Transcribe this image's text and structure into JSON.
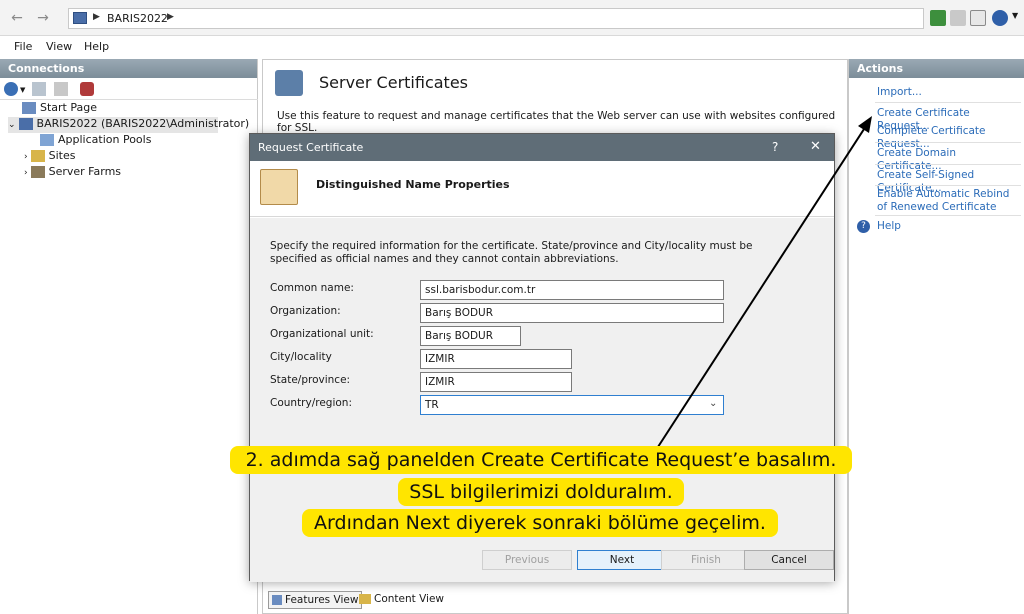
{
  "address_bar": {
    "path": [
      "BARIS2022"
    ],
    "nav_back_icon": "arrow-left-icon",
    "nav_forward_icon": "arrow-right-icon"
  },
  "menu": [
    "File",
    "View",
    "Help"
  ],
  "connections": {
    "title": "Connections",
    "tree": [
      {
        "label": "Start Page",
        "level": 1
      },
      {
        "label": "BARIS2022 (BARIS2022\\Administrator)",
        "level": 0
      },
      {
        "label": "Application Pools",
        "level": 2
      },
      {
        "label": "Sites",
        "level": 2
      },
      {
        "label": "Server Farms",
        "level": 2
      }
    ]
  },
  "main": {
    "title": "Server Certificates",
    "description": "Use this feature to request and manage certificates that the Web server can use with websites configured for SSL."
  },
  "actions": {
    "title": "Actions",
    "items": [
      "Import...",
      "Create Certificate Request...",
      "Complete Certificate Request...",
      "Create Domain Certificate...",
      "Create Self-Signed Certificate...",
      "Enable Automatic Rebind of Renewed Certificate",
      "Help"
    ]
  },
  "dialog": {
    "title": "Request Certificate",
    "help_glyph": "?",
    "close_glyph": "✕",
    "header": "Distinguished Name Properties",
    "instructions": "Specify the required information for the certificate. State/province and City/locality must be specified as official names and they cannot contain abbreviations.",
    "fields": [
      {
        "label": "Common name:",
        "value": "ssl.barisbodur.com.tr"
      },
      {
        "label": "Organization:",
        "value": "Barış BODUR"
      },
      {
        "label": "Organizational unit:",
        "value": "Barış BODUR"
      },
      {
        "label": "City/locality",
        "value": "IZMIR"
      },
      {
        "label": "State/province:",
        "value": "IZMIR"
      },
      {
        "label": "Country/region:",
        "value": "TR"
      }
    ],
    "buttons": {
      "previous": "Previous",
      "next": "Next",
      "finish": "Finish",
      "cancel": "Cancel"
    }
  },
  "callout": {
    "line1": "2. adımda sağ panelden Create Certificate Request’e basalım.",
    "line2": "SSL bilgilerimizi dolduralım.",
    "line3": "Ardından Next diyerek sonraki bölüme geçelim."
  },
  "bottom_tabs": [
    "Features View",
    "Content View"
  ],
  "colors": {
    "accent_link": "#2a6bb8",
    "callout_bg": "#ffe500",
    "dialog_title_bg": "#5f6d77"
  }
}
